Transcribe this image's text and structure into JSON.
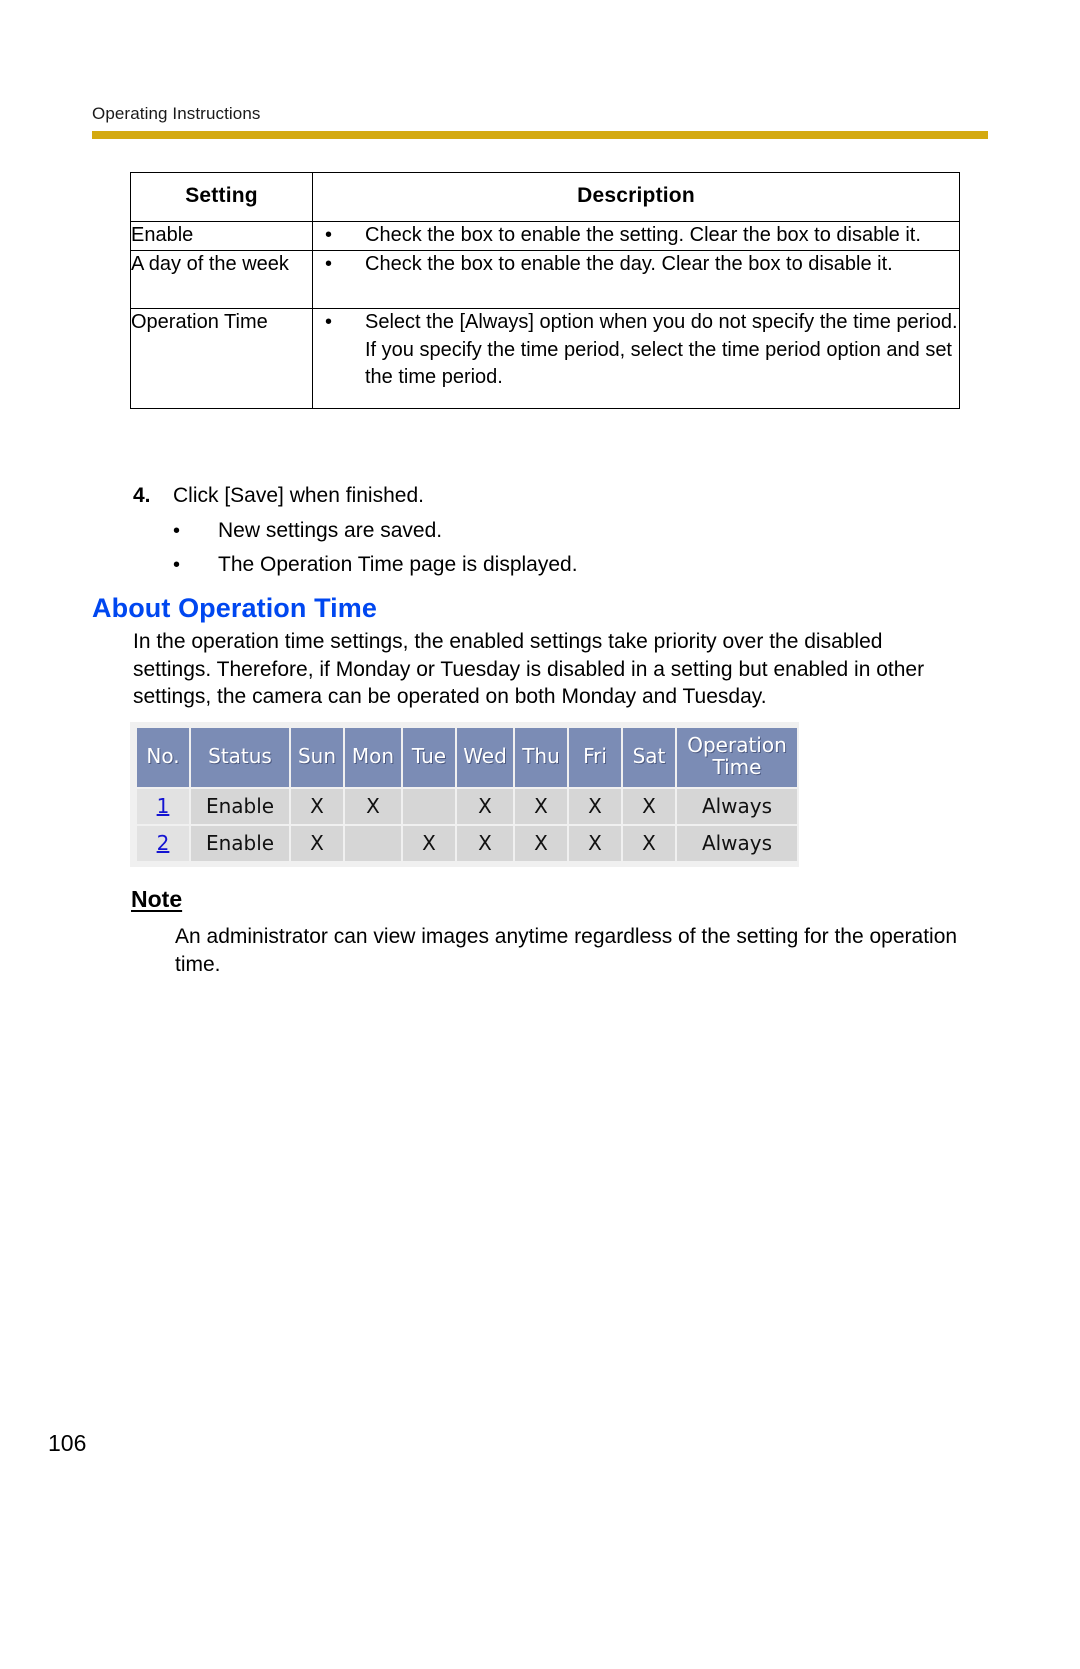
{
  "document": {
    "running_header": "Operating Instructions",
    "page_number": "106",
    "rule_color": "#d4aa11"
  },
  "settings_table": {
    "headers": [
      "Setting",
      "Description"
    ],
    "rows": [
      {
        "setting": "Enable",
        "bullet": "•",
        "description": "Check the box to enable the setting. Clear the box to disable it."
      },
      {
        "setting": "A day of the week",
        "bullet": "•",
        "description": "Check the box to enable the day. Clear the box to disable it."
      },
      {
        "setting": "Operation Time",
        "bullet": "•",
        "description": "Select the [Always] option when you do not specify the time period. If you specify the time period, select the time period option and set the time period."
      }
    ]
  },
  "step": {
    "number": "4.",
    "text": "Click [Save] when finished.",
    "bullet_mark": "•",
    "bullets": [
      "New settings are saved.",
      "The Operation Time page is displayed."
    ]
  },
  "section": {
    "heading": "About Operation Time",
    "heading_color": "#0047f0",
    "paragraph": "In the operation time settings, the enabled settings take priority over the disabled settings. Therefore, if Monday or Tuesday is disabled in a setting but enabled in other settings, the camera can be operated on both Monday and Tuesday."
  },
  "screenshot_table": {
    "header_bg": "#7b8cb5",
    "cell_bg": "#d6d6d6",
    "link_color": "#1414d2",
    "headers": [
      "No.",
      "Status",
      "Sun",
      "Mon",
      "Tue",
      "Wed",
      "Thu",
      "Fri",
      "Sat",
      "Operation Time"
    ],
    "mark": "X",
    "rows": [
      {
        "no": "1",
        "status": "Enable",
        "sun": "X",
        "mon": "X",
        "tue": "",
        "wed": "X",
        "thu": "X",
        "fri": "X",
        "sat": "X",
        "operation_time": "Always"
      },
      {
        "no": "2",
        "status": "Enable",
        "sun": "X",
        "mon": "",
        "tue": "X",
        "wed": "X",
        "thu": "X",
        "fri": "X",
        "sat": "X",
        "operation_time": "Always"
      }
    ]
  },
  "note": {
    "heading": "Note",
    "body": "An administrator can view images anytime regardless of the setting for the operation time."
  }
}
